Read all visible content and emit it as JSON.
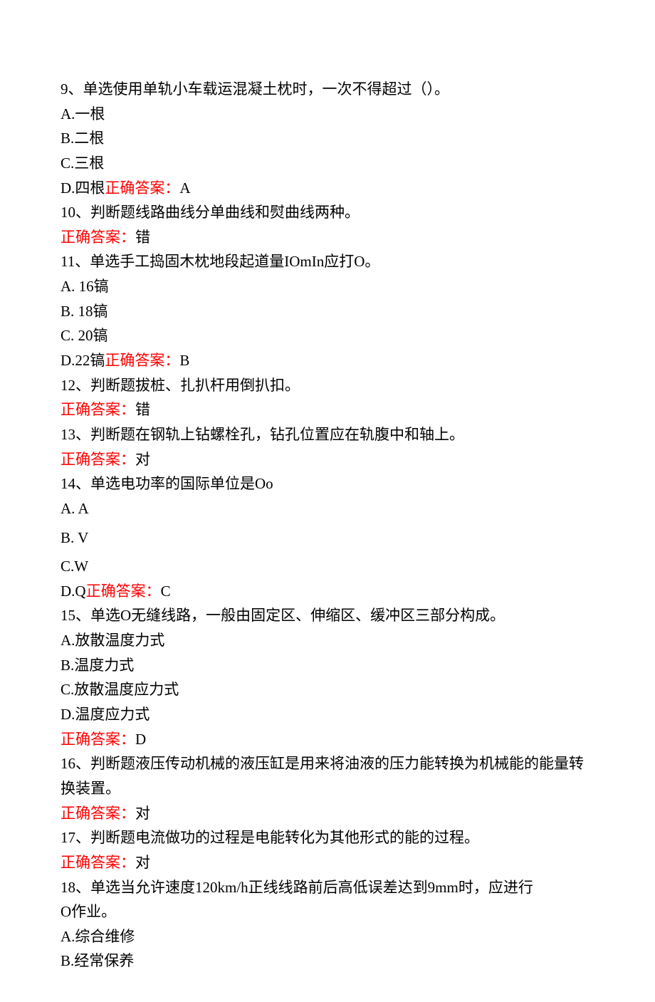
{
  "q9": {
    "stem": "9、单选使用单轨小车载运混凝土枕时，一次不得超过（）。",
    "optA": "A.一根",
    "optB": "B.二根",
    "optC": "C.三根",
    "optD_prefix": "D.四根",
    "ans_label": "正确答案：",
    "ans_value": "A"
  },
  "q10": {
    "stem": "10、判断题线路曲线分单曲线和熨曲线两种。",
    "ans_label": "正确答案：",
    "ans_value": "错"
  },
  "q11": {
    "stem": "11、单选手工捣固木枕地段起道量IOmIn应打O。",
    "optA": "A.  16镐",
    "optB": "B.  18镐",
    "optC": "C.  20镐",
    "optD_prefix": "D.22镐",
    "ans_label": "正确答案：",
    "ans_value": "B"
  },
  "q12": {
    "stem": "12、判断题拔桩、扎扒杆用倒扒扣。",
    "ans_label": "正确答案：",
    "ans_value": "错"
  },
  "q13": {
    "stem": "13、判断题在钢轨上钻螺栓孔，钻孔位置应在轨腹中和轴上。",
    "ans_label": "正确答案：",
    "ans_value": "对"
  },
  "q14": {
    "stem": "14、单选电功率的国际单位是Oo",
    "optA": "A.  A",
    "optB": "B.  V",
    "optC": "C.W",
    "optD_prefix": "D.Q",
    "ans_label": "正确答案：",
    "ans_value": "C"
  },
  "q15": {
    "stem": "15、单选O无缝线路，一般由固定区、伸缩区、缓冲区三部分构成。",
    "optA": "A.放散温度力式",
    "optB": "B.温度力式",
    "optC": "C.放散温度应力式",
    "optD": "D.温度应力式",
    "ans_label": "正确答案：",
    "ans_value": "D"
  },
  "q16": {
    "stem": "16、判断题液压传动机械的液压缸是用来将油液的压力能转换为机械能的能量转换装置。",
    "ans_label": "正确答案：",
    "ans_value": "对"
  },
  "q17": {
    "stem": "17、判断题电流做功的过程是电能转化为其他形式的能的过程。",
    "ans_label": "正确答案：",
    "ans_value": "对"
  },
  "q18": {
    "stem_line1": "18、单选当允许速度120km/h正线线路前后高低误差达到9mm时，应进行",
    "stem_line2": " O作业。",
    "optA": "A.综合维修",
    "optB": "B.经常保养"
  }
}
